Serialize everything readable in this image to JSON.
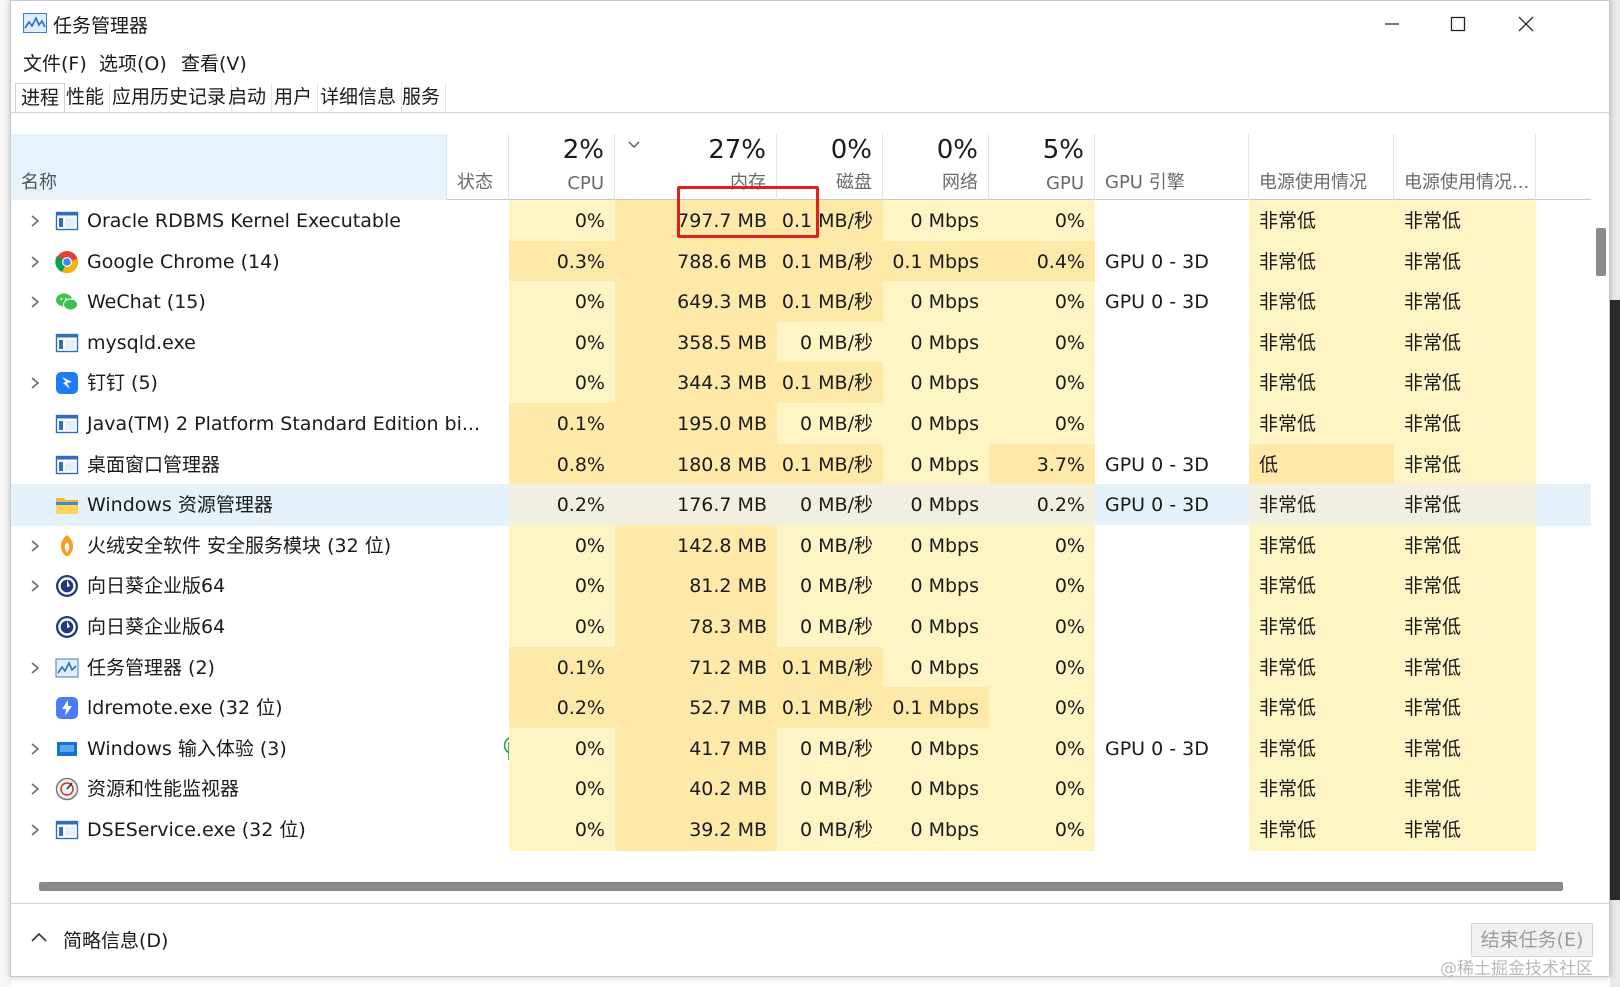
{
  "window": {
    "title": "任务管理器",
    "controls": {
      "minimize": "minimize-icon",
      "maximize": "maximize-icon",
      "close": "close-icon"
    }
  },
  "menu": [
    "文件(F)",
    "选项(O)",
    "查看(V)"
  ],
  "tabs": [
    "进程",
    "性能",
    "应用历史记录",
    "启动",
    "用户",
    "详细信息",
    "服务"
  ],
  "active_tab": "进程",
  "columns": {
    "name": {
      "label": "名称"
    },
    "status": {
      "label": "状态"
    },
    "cpu": {
      "pct": "2%",
      "label": "CPU"
    },
    "memory": {
      "pct": "27%",
      "label": "内存",
      "sorted": "descending"
    },
    "disk": {
      "pct": "0%",
      "label": "磁盘"
    },
    "network": {
      "pct": "0%",
      "label": "网络"
    },
    "gpu": {
      "pct": "5%",
      "label": "GPU"
    },
    "gpu_engine": {
      "label": "GPU 引擎"
    },
    "power": {
      "label": "电源使用情况"
    },
    "power_trend": {
      "label": "电源使用情况..."
    }
  },
  "processes": [
    {
      "name": "Oracle RDBMS Kernel Executable",
      "icon": "app-window-icon",
      "expandable": true,
      "status": "",
      "cpu": "0%",
      "memory": "797.7 MB",
      "disk": "0.1 MB/秒",
      "network": "0 Mbps",
      "gpu": "0%",
      "gpu_engine": "",
      "power": "非常低",
      "power_trend": "非常低"
    },
    {
      "name": "Google Chrome (14)",
      "icon": "chrome-icon",
      "expandable": true,
      "status": "",
      "cpu": "0.3%",
      "memory": "788.6 MB",
      "disk": "0.1 MB/秒",
      "network": "0.1 Mbps",
      "gpu": "0.4%",
      "gpu_engine": "GPU 0 - 3D",
      "power": "非常低",
      "power_trend": "非常低"
    },
    {
      "name": "WeChat (15)",
      "icon": "wechat-icon",
      "expandable": true,
      "status": "",
      "cpu": "0%",
      "memory": "649.3 MB",
      "disk": "0.1 MB/秒",
      "network": "0 Mbps",
      "gpu": "0%",
      "gpu_engine": "GPU 0 - 3D",
      "power": "非常低",
      "power_trend": "非常低"
    },
    {
      "name": "mysqld.exe",
      "icon": "app-window-icon",
      "expandable": false,
      "status": "",
      "cpu": "0%",
      "memory": "358.5 MB",
      "disk": "0 MB/秒",
      "network": "0 Mbps",
      "gpu": "0%",
      "gpu_engine": "",
      "power": "非常低",
      "power_trend": "非常低"
    },
    {
      "name": "钉钉 (5)",
      "icon": "dingtalk-icon",
      "expandable": true,
      "status": "",
      "cpu": "0%",
      "memory": "344.3 MB",
      "disk": "0.1 MB/秒",
      "network": "0 Mbps",
      "gpu": "0%",
      "gpu_engine": "",
      "power": "非常低",
      "power_trend": "非常低"
    },
    {
      "name": "Java(TM) 2 Platform Standard Edition bi...",
      "icon": "app-window-icon",
      "expandable": false,
      "status": "",
      "cpu": "0.1%",
      "memory": "195.0 MB",
      "disk": "0 MB/秒",
      "network": "0 Mbps",
      "gpu": "0%",
      "gpu_engine": "",
      "power": "非常低",
      "power_trend": "非常低"
    },
    {
      "name": "桌面窗口管理器",
      "icon": "app-window-icon",
      "expandable": false,
      "status": "",
      "cpu": "0.8%",
      "memory": "180.8 MB",
      "disk": "0.1 MB/秒",
      "network": "0 Mbps",
      "gpu": "3.7%",
      "gpu_engine": "GPU 0 - 3D",
      "power": "低",
      "power_trend": "非常低"
    },
    {
      "name": "Windows 资源管理器",
      "icon": "folder-icon",
      "expandable": false,
      "status": "",
      "cpu": "0.2%",
      "memory": "176.7 MB",
      "disk": "0 MB/秒",
      "network": "0 Mbps",
      "gpu": "0.2%",
      "gpu_engine": "GPU 0 - 3D",
      "power": "非常低",
      "power_trend": "非常低",
      "selected": true
    },
    {
      "name": "火绒安全软件 安全服务模块 (32 位)",
      "icon": "huorong-icon",
      "expandable": true,
      "status": "",
      "cpu": "0%",
      "memory": "142.8 MB",
      "disk": "0 MB/秒",
      "network": "0 Mbps",
      "gpu": "0%",
      "gpu_engine": "",
      "power": "非常低",
      "power_trend": "非常低"
    },
    {
      "name": "向日葵企业版64",
      "icon": "sunlogin-icon",
      "expandable": true,
      "status": "",
      "cpu": "0%",
      "memory": "81.2 MB",
      "disk": "0 MB/秒",
      "network": "0 Mbps",
      "gpu": "0%",
      "gpu_engine": "",
      "power": "非常低",
      "power_trend": "非常低"
    },
    {
      "name": "向日葵企业版64",
      "icon": "sunlogin-icon",
      "expandable": false,
      "status": "",
      "cpu": "0%",
      "memory": "78.3 MB",
      "disk": "0 MB/秒",
      "network": "0 Mbps",
      "gpu": "0%",
      "gpu_engine": "",
      "power": "非常低",
      "power_trend": "非常低"
    },
    {
      "name": "任务管理器 (2)",
      "icon": "task-manager-icon",
      "expandable": true,
      "status": "",
      "cpu": "0.1%",
      "memory": "71.2 MB",
      "disk": "0.1 MB/秒",
      "network": "0 Mbps",
      "gpu": "0%",
      "gpu_engine": "",
      "power": "非常低",
      "power_trend": "非常低"
    },
    {
      "name": "ldremote.exe (32 位)",
      "icon": "ldremote-icon",
      "expandable": false,
      "status": "",
      "cpu": "0.2%",
      "memory": "52.7 MB",
      "disk": "0.1 MB/秒",
      "network": "0.1 Mbps",
      "gpu": "0%",
      "gpu_engine": "",
      "power": "非常低",
      "power_trend": "非常低"
    },
    {
      "name": "Windows 输入体验 (3)",
      "icon": "input-experience-icon",
      "expandable": true,
      "status": "suspended-leaf-icon",
      "cpu": "0%",
      "memory": "41.7 MB",
      "disk": "0 MB/秒",
      "network": "0 Mbps",
      "gpu": "0%",
      "gpu_engine": "GPU 0 - 3D",
      "power": "非常低",
      "power_trend": "非常低"
    },
    {
      "name": "资源和性能监视器",
      "icon": "resource-monitor-icon",
      "expandable": true,
      "status": "",
      "cpu": "0%",
      "memory": "40.2 MB",
      "disk": "0 MB/秒",
      "network": "0 Mbps",
      "gpu": "0%",
      "gpu_engine": "",
      "power": "非常低",
      "power_trend": "非常低"
    },
    {
      "name": "DSEService.exe (32 位)",
      "icon": "app-window-icon",
      "expandable": true,
      "status": "",
      "cpu": "0%",
      "memory": "39.2 MB",
      "disk": "0 MB/秒",
      "network": "0 Mbps",
      "gpu": "0%",
      "gpu_engine": "",
      "power": "非常低",
      "power_trend": "非常低"
    }
  ],
  "footer": {
    "brief_label": "简略信息(D)",
    "end_task_label": "结束任务(E)"
  },
  "watermark": "@稀土掘金技术社区",
  "colors": {
    "heat_light": "#fff4c4",
    "heat_medium": "#ffe9a8",
    "selected_row": "#e5f1fb",
    "header_name_bg": "#e6f2fc",
    "annotation_red": "#e0201c"
  }
}
